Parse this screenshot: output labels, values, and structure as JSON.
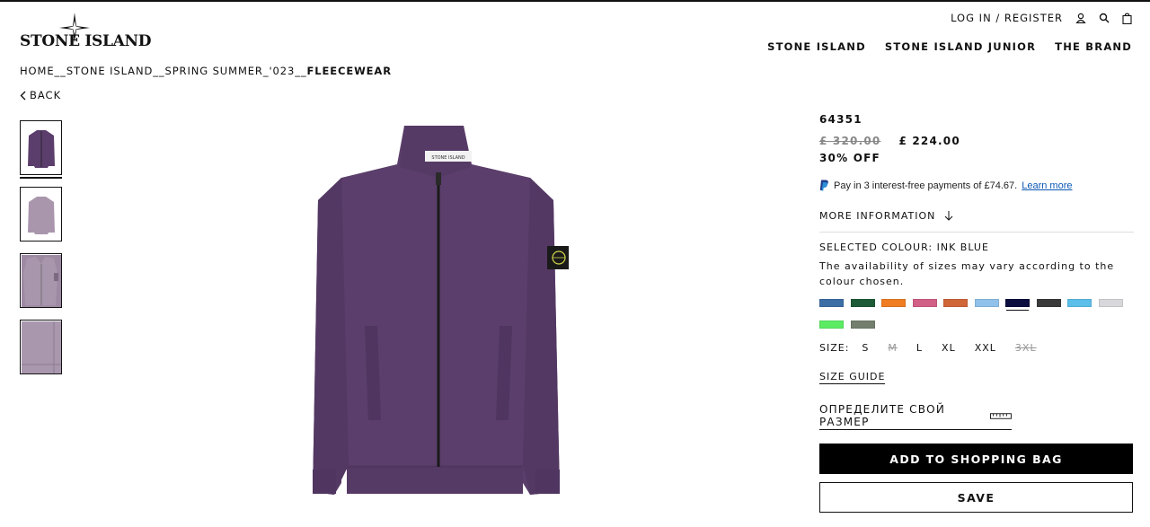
{
  "brand": {
    "logo_text": "STONE ISLAND"
  },
  "account": {
    "login_register": "LOG IN / REGISTER",
    "user_icon": "user-icon",
    "search_icon": "search-icon",
    "bag_icon": "shopping-bag-icon"
  },
  "nav": {
    "items": [
      "STONE ISLAND",
      "STONE ISLAND JUNIOR",
      "THE BRAND"
    ]
  },
  "breadcrumb": {
    "items": [
      "HOME",
      "STONE ISLAND",
      "SPRING SUMMER_'023"
    ],
    "separator": "__",
    "current": "FLEECEWEAR"
  },
  "back": {
    "label": "BACK",
    "icon": "chevron-left-icon"
  },
  "product": {
    "sku": "64351",
    "old_price": "£ 320.00",
    "price": "£ 224.00",
    "discount": "30% OFF",
    "paypal_text": "Pay in 3 interest-free payments of £74.67.",
    "paypal_link": "Learn more",
    "more_info": "MORE INFORMATION",
    "selected_colour": "SELECTED COLOUR: INK BLUE",
    "availability": "The availability of sizes may vary according to the colour chosen.",
    "swatches": [
      "#3d6ea6",
      "#1d5a37",
      "#f07d22",
      "#d25f86",
      "#d06537",
      "#8fc1ea",
      "#0c0d3f",
      "#3a3a3a",
      "#5bbfe9",
      "#d8d8dc",
      "#5cec64",
      "#737e6c"
    ],
    "selected_swatch_index": 6,
    "size_label": "SIZE:",
    "sizes": [
      {
        "label": "S",
        "available": true
      },
      {
        "label": "M",
        "available": false
      },
      {
        "label": "L",
        "available": true
      },
      {
        "label": "XL",
        "available": true
      },
      {
        "label": "XXL",
        "available": true
      },
      {
        "label": "3XL",
        "available": false
      }
    ],
    "size_guide": "SIZE GUIDE",
    "ru_size": "ОПРЕДЕЛИТЕ СВОЙ РАЗМЕР",
    "add_to_bag": "ADD TO SHOPPING BAG",
    "save": "SAVE"
  },
  "colors": {
    "garment": "#5b3e6b",
    "garment_dark": "#4a3159",
    "accent": "#000000"
  }
}
